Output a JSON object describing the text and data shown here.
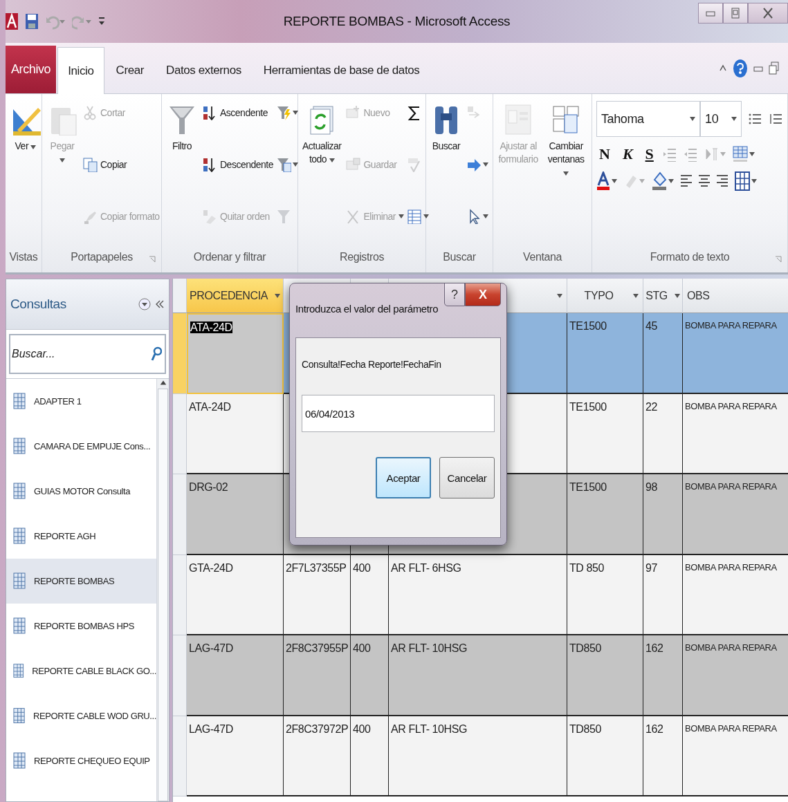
{
  "window": {
    "title": "REPORTE BOMBAS - Microsoft Access"
  },
  "ribbon": {
    "file_tab": "Archivo",
    "tabs": [
      {
        "label": "Inicio",
        "selected": true
      },
      {
        "label": "Crear",
        "selected": false
      },
      {
        "label": "Datos externos",
        "selected": false
      },
      {
        "label": "Herramientas de base de datos",
        "selected": false
      }
    ],
    "groups": [
      {
        "label": "Vistas",
        "launcher": false,
        "items": [
          {
            "kind": "large",
            "label": "Ver",
            "dropdown": true,
            "disabled": false
          }
        ]
      },
      {
        "label": "Portapapeles",
        "launcher": true,
        "items": [
          {
            "kind": "large",
            "label": "Pegar",
            "dropdown": true,
            "disabled": true
          },
          {
            "kind": "small",
            "label": "Cortar",
            "dropdown": false,
            "disabled": true
          },
          {
            "kind": "small",
            "label": "Copiar",
            "dropdown": false,
            "disabled": false
          },
          {
            "kind": "small",
            "label": "Copiar formato",
            "dropdown": false,
            "disabled": true
          }
        ]
      },
      {
        "label": "Ordenar y filtrar",
        "launcher": false,
        "items": [
          {
            "kind": "large",
            "label": "Filtro",
            "dropdown": false,
            "disabled": false
          },
          {
            "kind": "small",
            "label": "Ascendente",
            "dropdown": false,
            "disabled": false
          },
          {
            "kind": "small",
            "label": "Descendente",
            "dropdown": false,
            "disabled": false
          },
          {
            "kind": "small",
            "label": "Quitar orden",
            "dropdown": false,
            "disabled": true
          },
          {
            "kind": "icon",
            "dropdown": true,
            "disabled": false
          },
          {
            "kind": "icon",
            "dropdown": true,
            "disabled": false
          },
          {
            "kind": "icon",
            "dropdown": false,
            "disabled": true
          }
        ]
      },
      {
        "label": "Registros",
        "launcher": false,
        "items": [
          {
            "kind": "large",
            "label": "Actualizar todo",
            "dropdown": true,
            "disabled": false
          },
          {
            "kind": "small",
            "label": "Nuevo",
            "dropdown": false,
            "disabled": true
          },
          {
            "kind": "small",
            "label": "Guardar",
            "dropdown": false,
            "disabled": true
          },
          {
            "kind": "small",
            "label": "Eliminar",
            "dropdown": true,
            "disabled": true
          },
          {
            "kind": "icon",
            "dropdown": false,
            "disabled": false
          },
          {
            "kind": "icon",
            "dropdown": false,
            "disabled": true
          },
          {
            "kind": "icon",
            "dropdown": true,
            "disabled": false
          }
        ]
      },
      {
        "label": "Buscar",
        "launcher": false,
        "items": [
          {
            "kind": "large",
            "label": "Buscar",
            "dropdown": false,
            "disabled": false
          },
          {
            "kind": "icon",
            "dropdown": false,
            "disabled": true
          },
          {
            "kind": "icon",
            "dropdown": true,
            "disabled": false
          },
          {
            "kind": "icon",
            "dropdown": true,
            "disabled": false
          }
        ]
      },
      {
        "label": "Ventana",
        "launcher": false,
        "items": [
          {
            "kind": "large",
            "label": "Ajustar al formulario",
            "dropdown": false,
            "disabled": true
          },
          {
            "kind": "large",
            "label": "Cambiar ventanas",
            "dropdown": true,
            "disabled": false
          }
        ]
      }
    ],
    "text_format": {
      "label": "Formato de texto",
      "font": "Tahoma",
      "size": "10",
      "styles": [
        "N",
        "K",
        "S"
      ]
    }
  },
  "navigation": {
    "title": "Consultas",
    "search_placeholder": "Buscar...",
    "items": [
      {
        "label": "ADAPTER 1",
        "selected": false
      },
      {
        "label": "CAMARA DE EMPUJE Cons...",
        "selected": false
      },
      {
        "label": "GUIAS MOTOR Consulta",
        "selected": false
      },
      {
        "label": "REPORTE AGH",
        "selected": false
      },
      {
        "label": "REPORTE BOMBAS",
        "selected": true
      },
      {
        "label": "REPORTE BOMBAS HPS",
        "selected": false
      },
      {
        "label": "REPORTE CABLE BLACK GO...",
        "selected": false
      },
      {
        "label": "REPORTE CABLE WOD GRU...",
        "selected": false
      },
      {
        "label": "REPORTE CHEQUEO EQUIP",
        "selected": false
      }
    ]
  },
  "datasheet": {
    "columns": [
      {
        "label": "PROCEDENCIA",
        "selected": true,
        "dropdown": true
      },
      {
        "selected": false
      },
      {
        "selected": false
      },
      {
        "selected": false,
        "dropdown": true
      },
      {
        "label": "TYPO",
        "selected": false,
        "dropdown": true
      },
      {
        "label": "STG",
        "selected": false,
        "dropdown": true
      },
      {
        "label": "OBS",
        "selected": false,
        "dropdown": false
      }
    ],
    "rows": [
      {
        "selected": true,
        "cells": [
          "ATA-24D",
          null,
          null,
          null,
          "TE1500",
          "45",
          "BOMBA PARA REPARA"
        ]
      },
      {
        "selected": false,
        "cells": [
          "ATA-24D",
          null,
          null,
          null,
          "TE1500",
          "22",
          "BOMBA PARA REPARA"
        ]
      },
      {
        "selected": false,
        "cells": [
          "DRG-02",
          null,
          null,
          null,
          "TE1500",
          "98",
          "BOMBA PARA REPARA"
        ]
      },
      {
        "selected": false,
        "cells": [
          "GTA-24D",
          "2F7L37355P",
          "400",
          "AR FLT- 6HSG",
          "TD 850",
          "97",
          "BOMBA PARA REPARA"
        ]
      },
      {
        "selected": false,
        "cells": [
          "LAG-47D",
          "2F8C37955P",
          "400",
          "AR FLT- 10HSG",
          "TD850",
          "162",
          "BOMBA PARA REPARA"
        ]
      },
      {
        "selected": false,
        "cells": [
          "LAG-47D",
          "2F8C37972P",
          "400",
          "AR FLT- 10HSG",
          "TD850",
          "162",
          "BOMBA PARA REPARA"
        ]
      }
    ]
  },
  "dialog": {
    "title": "Introduzca el valor del parámetro",
    "help": "?",
    "close": "X",
    "prompt": "Consulta!Fecha Reporte!FechaFin",
    "value": "06/04/2013",
    "buttons": [
      {
        "label": "Aceptar",
        "default": true
      },
      {
        "label": "Cancelar",
        "default": false
      }
    ]
  }
}
